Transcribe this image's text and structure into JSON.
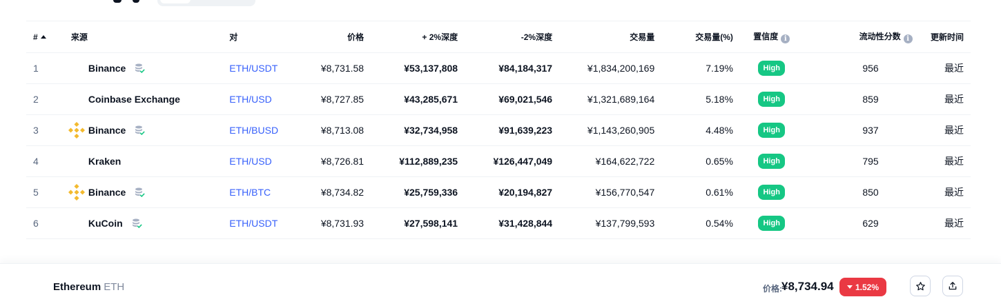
{
  "table": {
    "headers": {
      "rank": "#",
      "source": "来源",
      "pair": "对",
      "price": "价格",
      "plus_depth": "+ 2%深度",
      "minus_depth": "-2%深度",
      "volume": "交易量",
      "volume_pct": "交易量(%)",
      "confidence": "置信度",
      "liquidity": "流动性分数",
      "updated": "更新时间"
    },
    "rows": [
      {
        "rank": "1",
        "source": "Binance",
        "logo": "none",
        "stack_icon": true,
        "pair": "ETH/USDT",
        "price": "¥8,731.58",
        "plus_depth": "¥53,137,808",
        "minus_depth": "¥84,184,317",
        "volume": "¥1,834,200,169",
        "volume_pct": "7.19%",
        "confidence": "High",
        "liquidity": "956",
        "updated": "最近"
      },
      {
        "rank": "2",
        "source": "Coinbase Exchange",
        "logo": "none",
        "stack_icon": false,
        "pair": "ETH/USD",
        "price": "¥8,727.85",
        "plus_depth": "¥43,285,671",
        "minus_depth": "¥69,021,546",
        "volume": "¥1,321,689,164",
        "volume_pct": "5.18%",
        "confidence": "High",
        "liquidity": "859",
        "updated": "最近"
      },
      {
        "rank": "3",
        "source": "Binance",
        "logo": "binance-logo-icon",
        "stack_icon": true,
        "pair": "ETH/BUSD",
        "price": "¥8,713.08",
        "plus_depth": "¥32,734,958",
        "minus_depth": "¥91,639,223",
        "volume": "¥1,143,260,905",
        "volume_pct": "4.48%",
        "confidence": "High",
        "liquidity": "937",
        "updated": "最近"
      },
      {
        "rank": "4",
        "source": "Kraken",
        "logo": "none",
        "stack_icon": false,
        "pair": "ETH/USD",
        "price": "¥8,726.81",
        "plus_depth": "¥112,889,235",
        "minus_depth": "¥126,447,049",
        "volume": "¥164,622,722",
        "volume_pct": "0.65%",
        "confidence": "High",
        "liquidity": "795",
        "updated": "最近"
      },
      {
        "rank": "5",
        "source": "Binance",
        "logo": "binance-logo-icon",
        "stack_icon": true,
        "pair": "ETH/BTC",
        "price": "¥8,734.82",
        "plus_depth": "¥25,759,336",
        "minus_depth": "¥20,194,827",
        "volume": "¥156,770,547",
        "volume_pct": "0.61%",
        "confidence": "High",
        "liquidity": "850",
        "updated": "最近"
      },
      {
        "rank": "6",
        "source": "KuCoin",
        "logo": "none",
        "stack_icon": true,
        "pair": "ETH/USDT",
        "price": "¥8,731.93",
        "plus_depth": "¥27,598,141",
        "minus_depth": "¥31,428,844",
        "volume": "¥137,799,593",
        "volume_pct": "0.54%",
        "confidence": "High",
        "liquidity": "629",
        "updated": "最近"
      }
    ]
  },
  "footer": {
    "coin_name": "Ethereum",
    "coin_symbol": "ETH",
    "price_label": "价格:",
    "price_value": "¥8,734.94",
    "change": "1.52%",
    "change_direction": "down"
  },
  "colors": {
    "pair_link": "#3861fb",
    "high_badge": "#16c784",
    "down_badge": "#ea3943",
    "binance_yellow": "#f3ba2f"
  },
  "icons": [
    "sort-up-icon",
    "info-icon",
    "binance-logo-icon",
    "verified-stack-icon",
    "star-icon",
    "share-icon",
    "caret-down-icon"
  ]
}
